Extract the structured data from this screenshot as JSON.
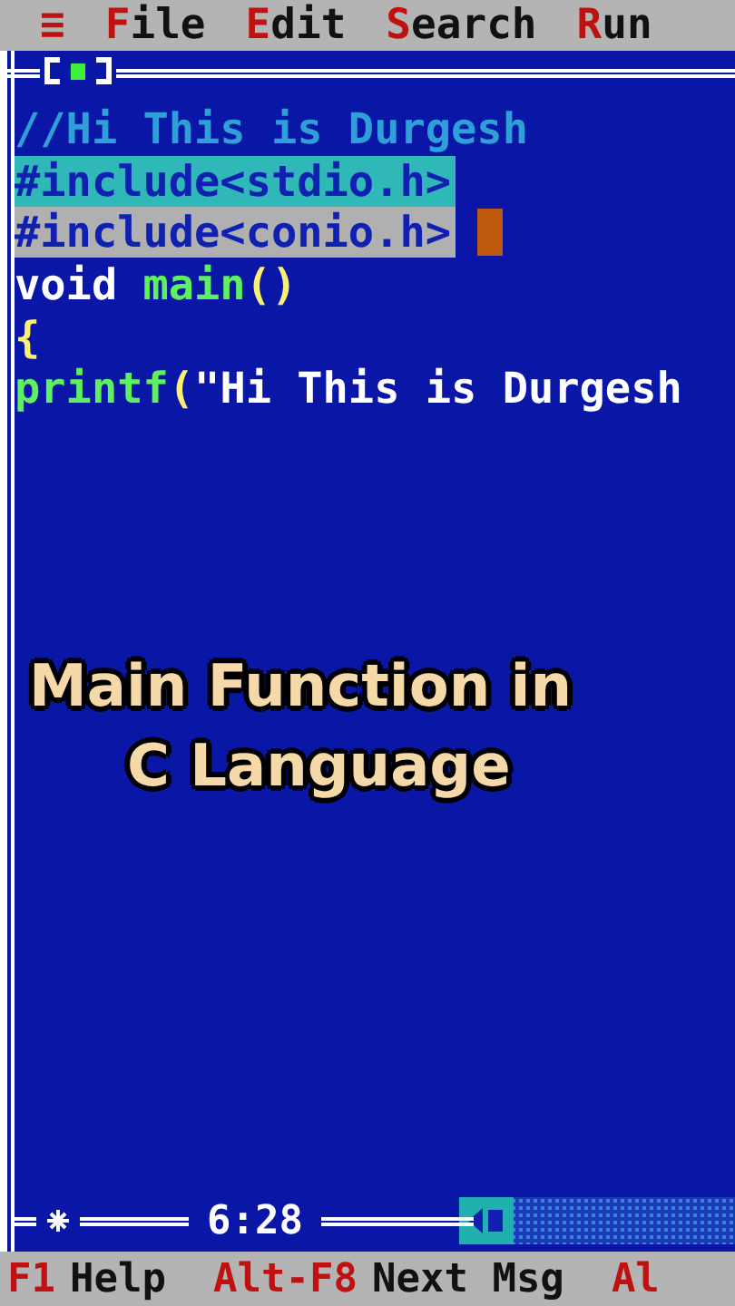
{
  "menu": [
    {
      "label": "≡",
      "kind": "system"
    },
    {
      "label": "File",
      "kind": "menu"
    },
    {
      "label": "Edit",
      "kind": "menu"
    },
    {
      "label": "Search",
      "kind": "menu"
    },
    {
      "label": "Run",
      "kind": "menu"
    }
  ],
  "editor": {
    "lines": [
      {
        "selected": false,
        "cursor": false,
        "tokens": [
          {
            "text": "//Hi This is Durgesh",
            "color": "#2f9fd8"
          }
        ]
      },
      {
        "selected": true,
        "color": "#30b8b8",
        "cursor": false,
        "tokens": [
          {
            "text": "#include<stdio.h>",
            "color": "#1020b0"
          }
        ]
      },
      {
        "selected": true,
        "color": "#b0b0b0",
        "cursor": true,
        "tokens": [
          {
            "text": "#include<conio.h>",
            "color": "#1020b0"
          }
        ]
      },
      {
        "selected": false,
        "cursor": false,
        "tokens": [
          {
            "text": "void",
            "color": "#ffffff"
          },
          {
            "text": " main",
            "color": "#5ef05e"
          },
          {
            "text": "()",
            "color": "#f8f070"
          }
        ]
      },
      {
        "selected": false,
        "cursor": false,
        "tokens": [
          {
            "text": "{",
            "color": "#f8f070"
          }
        ]
      },
      {
        "selected": false,
        "cursor": false,
        "tokens": [
          {
            "text": "printf",
            "color": "#5ef05e"
          },
          {
            "text": "(",
            "color": "#f8f070"
          },
          {
            "text": "\"Hi This is Durgesh",
            "color": "#ffffff"
          }
        ]
      }
    ],
    "position": "6:28"
  },
  "caption": [
    "Main Function in",
    "C Language"
  ],
  "status_bar": [
    {
      "key": "F1",
      "label": "Help"
    },
    {
      "key": "Alt-F8",
      "label": "Next Msg"
    },
    {
      "key": "Al"
    }
  ]
}
